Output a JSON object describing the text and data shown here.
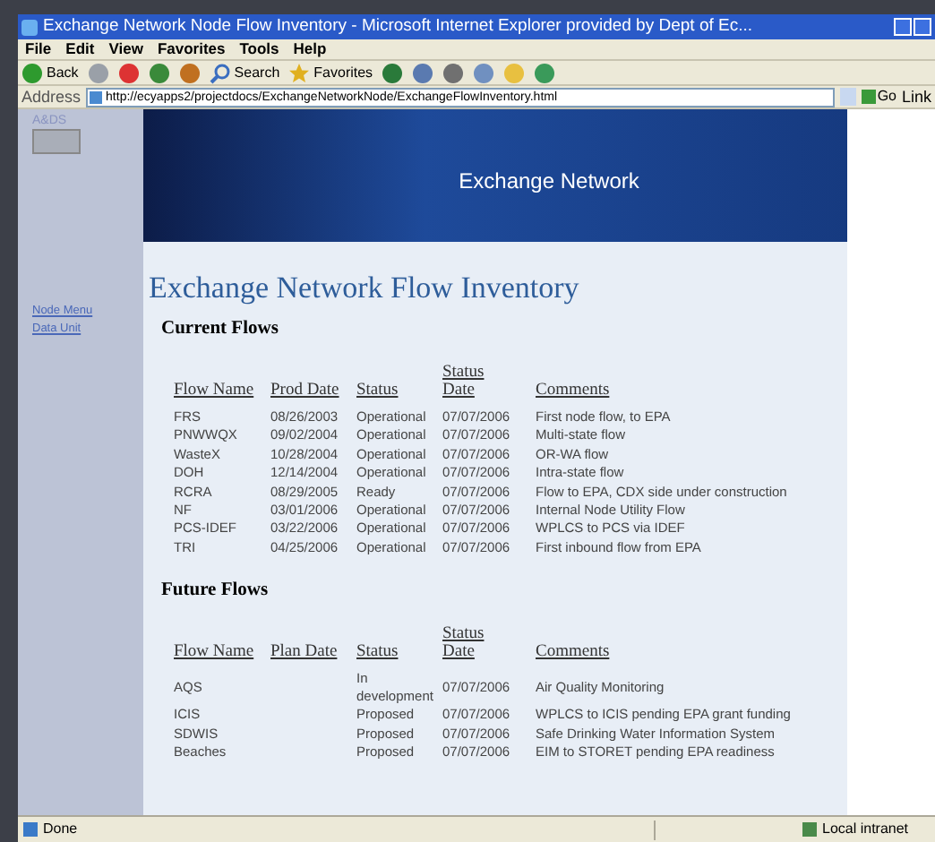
{
  "window": {
    "title": "Exchange Network Node Flow Inventory - Microsoft Internet Explorer provided by Dept of Ec..."
  },
  "menu": [
    "File",
    "Edit",
    "View",
    "Favorites",
    "Tools",
    "Help"
  ],
  "toolbar": [
    {
      "kind": "back",
      "label": "Back"
    },
    {
      "kind": "forward"
    },
    {
      "kind": "stop"
    },
    {
      "kind": "refresh"
    },
    {
      "kind": "home"
    },
    {
      "kind": "search",
      "label": "Search"
    },
    {
      "kind": "favorites",
      "label": "Favorites"
    },
    {
      "kind": "media"
    },
    {
      "kind": "mail"
    },
    {
      "kind": "print"
    },
    {
      "kind": "edit"
    },
    {
      "kind": "folder"
    },
    {
      "kind": "messenger"
    }
  ],
  "address": {
    "label": "Address",
    "url": "http://ecyapps2/projectdocs/ExchangeNetworkNode/ExchangeFlowInventory.html",
    "go": "Go",
    "links": "Link"
  },
  "sidebar": {
    "label": "A&DS",
    "links": [
      "Node Menu",
      "Data Unit"
    ]
  },
  "banner": {
    "title": "Exchange Network"
  },
  "page": {
    "heading": "Exchange Network Flow Inventory"
  },
  "sections": [
    {
      "title": "Current Flows",
      "columns": [
        "Flow Name",
        "Prod Date",
        "Status",
        "Status Date",
        "Comments"
      ],
      "rows": [
        {
          "name": "FRS",
          "date": "08/26/2003",
          "status": "Operational",
          "status_date": "07/07/2006",
          "comments": "First node flow, to EPA"
        },
        {
          "name": "PNWWQX",
          "date": "09/02/2004",
          "status": "Operational",
          "status_date": "07/07/2006",
          "comments": "Multi-state flow"
        },
        {
          "name": "WasteX",
          "date": "10/28/2004",
          "status": "Operational",
          "status_date": "07/07/2006",
          "comments": "OR-WA flow"
        },
        {
          "name": "DOH",
          "date": "12/14/2004",
          "status": "Operational",
          "status_date": "07/07/2006",
          "comments": "Intra-state flow"
        },
        {
          "name": "RCRA",
          "date": "08/29/2005",
          "status": "Ready",
          "status_date": "07/07/2006",
          "comments": "Flow to EPA, CDX side under construction"
        },
        {
          "name": "NF",
          "date": "03/01/2006",
          "status": "Operational",
          "status_date": "07/07/2006",
          "comments": "Internal Node Utility Flow"
        },
        {
          "name": "PCS-IDEF",
          "date": "03/22/2006",
          "status": "Operational",
          "status_date": "07/07/2006",
          "comments": "WPLCS to PCS via IDEF"
        },
        {
          "name": "TRI",
          "date": "04/25/2006",
          "status": "Operational",
          "status_date": "07/07/2006",
          "comments": "First inbound flow from EPA"
        }
      ]
    },
    {
      "title": "Future Flows",
      "columns": [
        "Flow Name",
        "Plan Date",
        "Status",
        "Status Date",
        "Comments"
      ],
      "rows": [
        {
          "name": "AQS",
          "status": "In development",
          "status_date": "07/07/2006",
          "comments": "Air Quality Monitoring"
        },
        {
          "name": "ICIS",
          "status": "Proposed",
          "status_date": "07/07/2006",
          "comments": "WPLCS to ICIS pending EPA grant funding"
        },
        {
          "name": "SDWIS",
          "status": "Proposed",
          "status_date": "07/07/2006",
          "comments": "Safe Drinking Water Information System"
        },
        {
          "name": "Beaches",
          "status": "Proposed",
          "status_date": "07/07/2006",
          "comments": "EIM to STORET pending EPA readiness"
        }
      ]
    }
  ],
  "status_bar": {
    "text": "Done",
    "zone": "Local intranet"
  }
}
